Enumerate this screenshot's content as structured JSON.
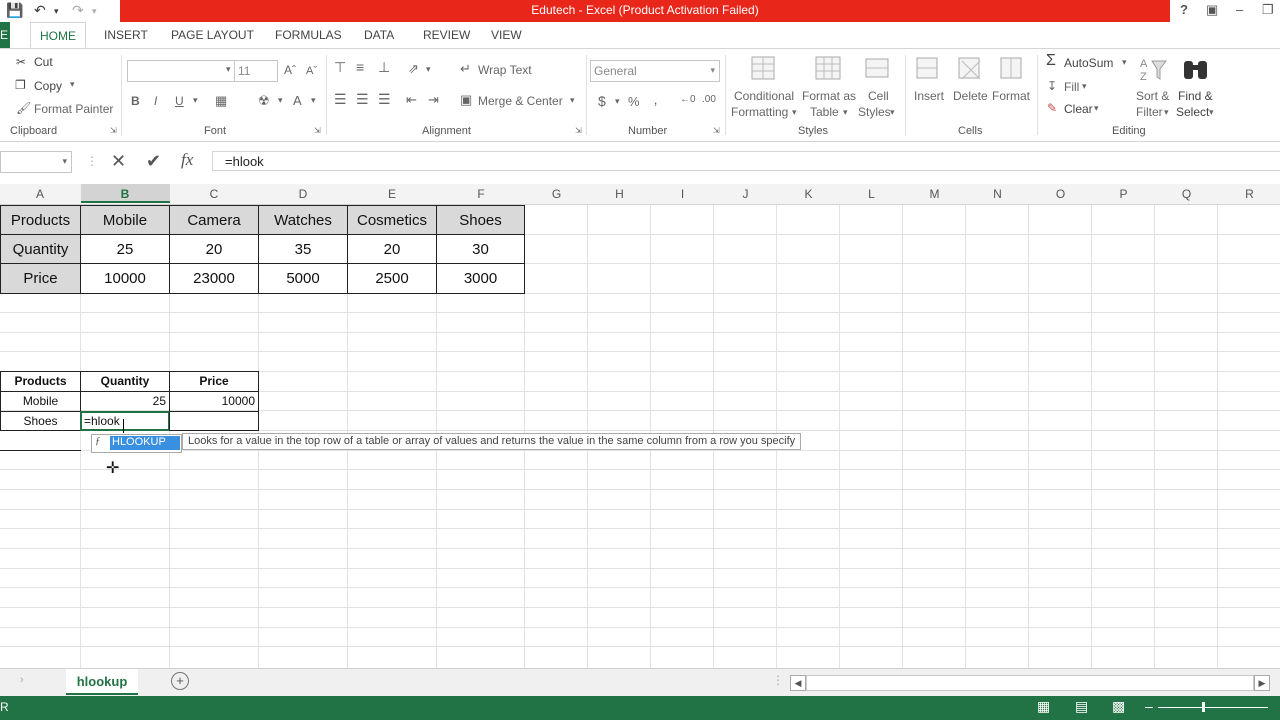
{
  "titlebar": {
    "title": "Edutech -  Excel (Product Activation Failed)",
    "help": "?",
    "minimize": "–"
  },
  "tabs": {
    "file": "E",
    "items": [
      "HOME",
      "INSERT",
      "PAGE LAYOUT",
      "FORMULAS",
      "DATA",
      "REVIEW",
      "VIEW"
    ]
  },
  "ribbon": {
    "clipboard": {
      "cut": "Cut",
      "copy": "Copy",
      "format_painter": "Format Painter",
      "label": "Clipboard"
    },
    "font": {
      "size": "11",
      "bold": "B",
      "italic": "I",
      "underline": "U",
      "label": "Font"
    },
    "alignment": {
      "wrap_text": "Wrap Text",
      "merge_center": "Merge & Center",
      "label": "Alignment"
    },
    "number": {
      "format": "General",
      "currency": "$",
      "percent": "%",
      "comma": "‚",
      "label": "Number"
    },
    "styles": {
      "conditional": "Conditional",
      "formatting": "Formatting",
      "format_as": "Format as",
      "table": "Table",
      "cell": "Cell",
      "styles_txt": "Styles",
      "label": "Styles"
    },
    "cells": {
      "insert": "Insert",
      "delete": "Delete",
      "format": "Format",
      "label": "Cells"
    },
    "editing": {
      "autosum": "AutoSum",
      "fill": "Fill",
      "clear": "Clear",
      "sort": "Sort &",
      "filter": "Filter",
      "find": "Find &",
      "select": "Select",
      "label": "Editing"
    }
  },
  "formula_bar": {
    "cancel": "✕",
    "enter": "✔",
    "fx": "fx",
    "value": "=hlook"
  },
  "columns": [
    "A",
    "B",
    "C",
    "D",
    "E",
    "F",
    "G",
    "H",
    "I",
    "J",
    "K",
    "L",
    "M",
    "N",
    "O",
    "P",
    "Q",
    "R"
  ],
  "table1": {
    "rows": [
      [
        "Products",
        "Mobile",
        "Camera",
        "Watches",
        "Cosmetics",
        "Shoes"
      ],
      [
        "Quantity",
        "25",
        "20",
        "35",
        "20",
        "30"
      ],
      [
        "Price",
        "10000",
        "23000",
        "5000",
        "2500",
        "3000"
      ]
    ]
  },
  "table2": {
    "headers": [
      "Products",
      "Quantity",
      "Price"
    ],
    "rows": [
      [
        "Mobile",
        "25",
        "10000"
      ],
      [
        "Shoes",
        "=hlook",
        ""
      ]
    ]
  },
  "autocomplete": {
    "item": "HLOOKUP",
    "tooltip": "Looks for a value in the top row of a table or array of values and returns the value in the same column from a row you specify"
  },
  "sheet": {
    "name": "hlookup",
    "add": "+"
  },
  "status": {
    "mode": "R"
  },
  "colors": {
    "excel_green": "#217346",
    "title_red": "#e8261a",
    "header_fill": "#d9d9d9",
    "highlight_blue": "#3990e0"
  }
}
